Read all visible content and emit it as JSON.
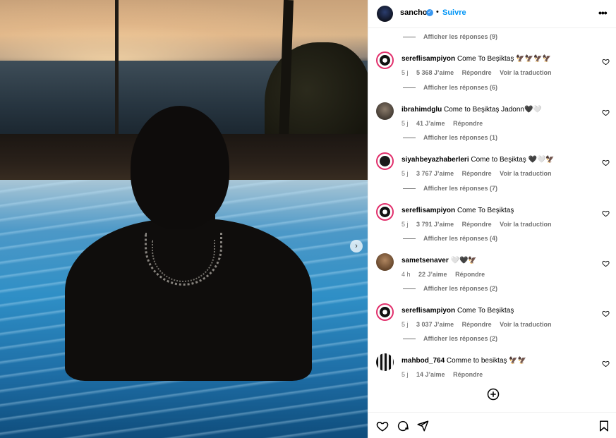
{
  "header": {
    "username": "sancho",
    "separator": "•",
    "follow_label": "Suivre",
    "more_label": "•••",
    "verified_mark": "✓"
  },
  "photo": {
    "next_icon": "›",
    "description_icons": [
      "chevron-right-icon"
    ]
  },
  "comments": [
    {
      "replies_before": "Afficher les réponses (9)",
      "username": "sereflisampiyon",
      "text": "Come To Beşiktaş 🦅🦅🦅🦅",
      "time": "5 j",
      "likes": "5 368 J’aime",
      "reply": "Répondre",
      "translate": "Voir la traduction"
    },
    {
      "replies_before": "Afficher les réponses (6)",
      "username": "ibrahimdglu",
      "text": "Come to Beşiktaş Jadonn🖤🤍",
      "time": "5 j",
      "likes": "41 J’aime",
      "reply": "Répondre",
      "translate": ""
    },
    {
      "replies_before": "Afficher les réponses (1)",
      "username": "siyahbeyazhaberleri",
      "text": "Come to Beşiktaş 🖤🤍🦅",
      "time": "5 j",
      "likes": "3 767 J’aime",
      "reply": "Répondre",
      "translate": "Voir la traduction"
    },
    {
      "replies_before": "Afficher les réponses (7)",
      "username": "sereflisampiyon",
      "text": "Come To Beşiktaş",
      "time": "5 j",
      "likes": "3 791 J’aime",
      "reply": "Répondre",
      "translate": "Voir la traduction"
    },
    {
      "replies_before": "Afficher les réponses (4)",
      "username": "sametsenaver",
      "text": "🤍🖤🦅",
      "time": "4 h",
      "likes": "22 J’aime",
      "reply": "Répondre",
      "translate": ""
    },
    {
      "replies_before": "Afficher les réponses (2)",
      "username": "sereflisampiyon",
      "text": "Come To Beşiktaş",
      "time": "5 j",
      "likes": "3 037 J’aime",
      "reply": "Répondre",
      "translate": "Voir la traduction"
    },
    {
      "replies_before": "Afficher les réponses (2)",
      "username": "mahbod_764",
      "text": "Comme to besiktaş 🦅🦅",
      "time": "5 j",
      "likes": "14 J’aime",
      "reply": "Répondre",
      "translate": ""
    }
  ],
  "colors": {
    "link_blue": "#0095f6",
    "verified_blue": "#3897f0",
    "meta_gray": "#737373",
    "story_ring": "#e1306c"
  },
  "icons": [
    "heart-icon",
    "comment-icon",
    "share-icon",
    "bookmark-icon",
    "plus-circle-icon",
    "more-icon"
  ]
}
